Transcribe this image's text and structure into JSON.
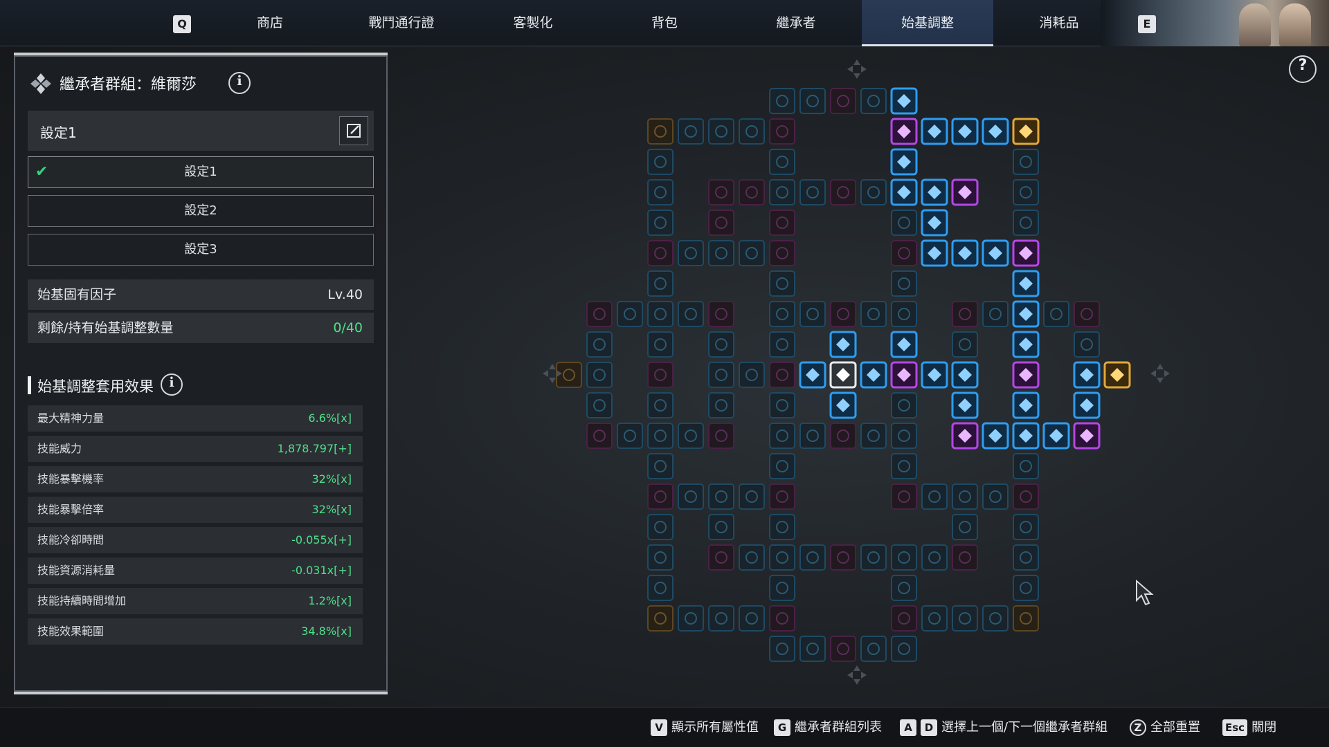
{
  "nav": {
    "left_key": "Q",
    "right_key": "E",
    "tabs": [
      {
        "label": "商店",
        "active": false
      },
      {
        "label": "戰鬥通行證",
        "active": false
      },
      {
        "label": "客製化",
        "active": false
      },
      {
        "label": "背包",
        "active": false
      },
      {
        "label": "繼承者",
        "active": false
      },
      {
        "label": "始基調整",
        "active": true
      },
      {
        "label": "消耗品",
        "active": false
      }
    ]
  },
  "panel": {
    "group_title": "繼承者群組：維爾莎",
    "info_icon": "i",
    "preset_current": "設定1",
    "presets": [
      {
        "label": "設定1",
        "selected": true
      },
      {
        "label": "設定2",
        "selected": false
      },
      {
        "label": "設定3",
        "selected": false
      }
    ],
    "inherent_factor_label": "始基固有因子",
    "inherent_factor_value": "Lv.40",
    "remaining_label": "剩餘/持有始基調整數量",
    "remaining_value": "0/40",
    "effects_title": "始基調整套用效果",
    "effects": [
      {
        "label": "最大精神力量",
        "value": "6.6%[x]"
      },
      {
        "label": "技能威力",
        "value": "1,878.797[+]"
      },
      {
        "label": "技能暴擊機率",
        "value": "32%[x]"
      },
      {
        "label": "技能暴擊倍率",
        "value": "32%[x]"
      },
      {
        "label": "技能冷卻時間",
        "value": "-0.055x[+]"
      },
      {
        "label": "技能資源消耗量",
        "value": "-0.031x[+]"
      },
      {
        "label": "技能持續時間增加",
        "value": "1.2%[x]"
      },
      {
        "label": "技能效果範圍",
        "value": "34.8%[x]"
      }
    ]
  },
  "help_label": "?",
  "hints": [
    {
      "keys": [
        "V"
      ],
      "label": "顯示所有屬性值"
    },
    {
      "keys": [
        "G"
      ],
      "label": "繼承者群組列表"
    },
    {
      "keys": [
        "A",
        "D"
      ],
      "label": "選擇上一個/下一個繼承者群組"
    },
    {
      "keys": [
        "Z"
      ],
      "label": "全部重置",
      "round": true
    },
    {
      "keys": [
        "Esc"
      ],
      "label": "關閉"
    }
  ],
  "colors": {
    "active_blue": "#2f9df0",
    "active_purple": "#b447e6",
    "gold": "#e2a83a",
    "inactive_blue": "#1f4a63",
    "inactive_purple": "#4a2146",
    "inactive_gold": "#5c4722",
    "positive_green": "#4fe08a"
  }
}
